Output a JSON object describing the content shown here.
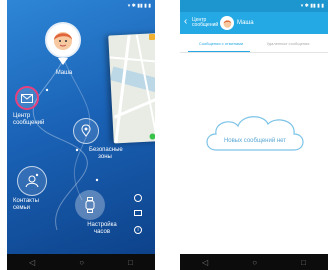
{
  "screenA": {
    "profile": {
      "name": "Маша"
    },
    "menu": {
      "messages": "Центр сообщений",
      "safe_zones": "Безопасные зоны",
      "contacts": "Контакты семьи",
      "settings": "Настройка часов"
    },
    "colors": {
      "background": "#1a62b6",
      "accent": "#e8407d"
    }
  },
  "screenB": {
    "header": {
      "back_label": "Центр сообщений",
      "child_name": "Маша"
    },
    "tabs": [
      "Сообщения с отменами",
      "Удаленные сообщения"
    ],
    "empty_message": "Новых сообщений нет",
    "colors": {
      "toolbar": "#25a9e4"
    }
  }
}
